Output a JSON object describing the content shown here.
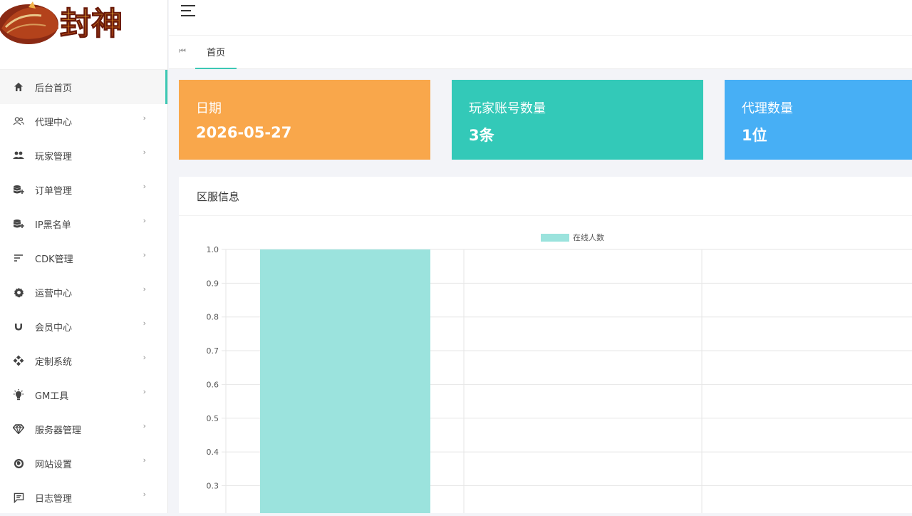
{
  "logo": {
    "text": "封神"
  },
  "sidebar": {
    "items": [
      {
        "label": "后台首页",
        "icon": "home-icon",
        "active": true,
        "has_children": false
      },
      {
        "label": "代理中心",
        "icon": "users-outline-icon",
        "has_children": true
      },
      {
        "label": "玩家管理",
        "icon": "people-icon",
        "has_children": true
      },
      {
        "label": "订单管理",
        "icon": "database-plus-icon",
        "has_children": true
      },
      {
        "label": "IP黑名单",
        "icon": "database-plus-icon",
        "has_children": true
      },
      {
        "label": "CDK管理",
        "icon": "sort-lines-icon",
        "has_children": true
      },
      {
        "label": "运营中心",
        "icon": "gear-icon",
        "has_children": true
      },
      {
        "label": "会员中心",
        "icon": "magnet-icon",
        "has_children": true
      },
      {
        "label": "定制系统",
        "icon": "diamond-grid-icon",
        "has_children": true
      },
      {
        "label": "GM工具",
        "icon": "bulb-icon",
        "has_children": true
      },
      {
        "label": "服务器管理",
        "icon": "gem-icon",
        "has_children": true
      },
      {
        "label": "网站设置",
        "icon": "globe-icon",
        "has_children": true
      },
      {
        "label": "日志管理",
        "icon": "message-icon",
        "has_children": true
      }
    ]
  },
  "tabs": {
    "home_label": "首页"
  },
  "stats": {
    "date": {
      "label": "日期",
      "value": "2026-05-27",
      "color": "#f9a74b"
    },
    "players": {
      "label": "玩家账号数量",
      "value": "3条",
      "color": "#33c9b8"
    },
    "agents": {
      "label": "代理数量",
      "value": "1位",
      "color": "#47aff5"
    }
  },
  "panel": {
    "title": "区服信息"
  },
  "chart_data": {
    "type": "bar",
    "categories": [
      ""
    ],
    "series": [
      {
        "name": "在线人数",
        "values": [
          1
        ],
        "color": "#9be3dd"
      }
    ],
    "yticks": [
      "1.0",
      "0.9",
      "0.8",
      "0.7",
      "0.6",
      "0.5",
      "0.4",
      "0.3"
    ],
    "ylim": [
      0,
      1
    ],
    "grid": true,
    "legend": "top-center"
  }
}
